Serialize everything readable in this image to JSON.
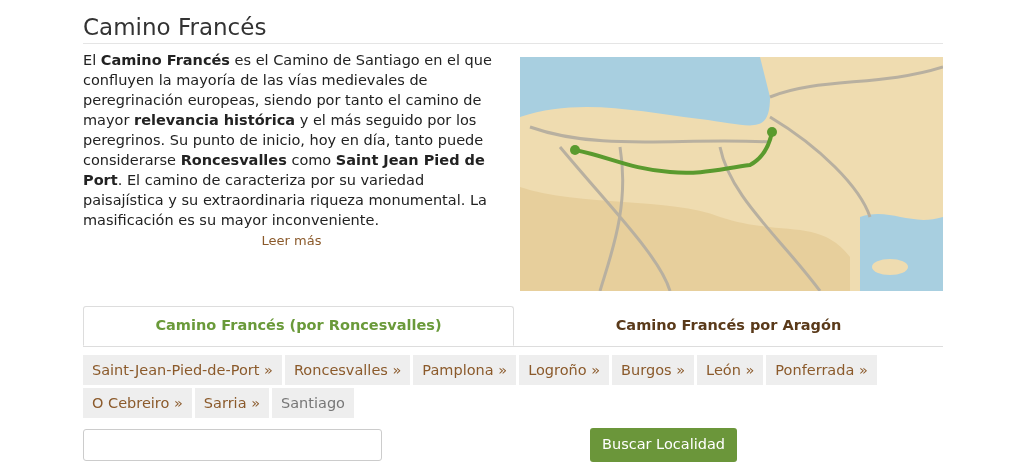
{
  "title": "Camino Francés",
  "intro": "El **Camino Francés** es el Camino de Santiago en el que confluyen la mayoría de las vías medievales de peregrinación europeas, siendo por tanto el camino de mayor **relevancia histórica** y el más seguido por los peregrinos. Su punto de inicio, hoy en día, tanto puede considerarse **Roncesvalles** como **Saint Jean Pied de Port**. El camino de caracteriza por su variedad paisajística y su extraordinaria riqueza monumental. La masificación es su mayor inconveniente.",
  "read_more": "Leer más",
  "tabs": [
    {
      "label": "Camino Francés (por Roncesvalles)",
      "selected": true
    },
    {
      "label": "Camino Francés por Aragón",
      "selected": false
    }
  ],
  "stages": [
    {
      "label": "Saint-Jean-Pied-de-Port »",
      "link": true
    },
    {
      "label": "Roncesvalles »",
      "link": true
    },
    {
      "label": "Pamplona »",
      "link": true
    },
    {
      "label": "Logroño »",
      "link": true
    },
    {
      "label": "Burgos »",
      "link": true
    },
    {
      "label": "León »",
      "link": true
    },
    {
      "label": "Ponferrada »",
      "link": true
    },
    {
      "label": "O Cebreiro »",
      "link": true
    },
    {
      "label": "Sarria »",
      "link": true
    },
    {
      "label": "Santiago",
      "link": false
    }
  ],
  "search": {
    "button": "Buscar Localidad"
  }
}
